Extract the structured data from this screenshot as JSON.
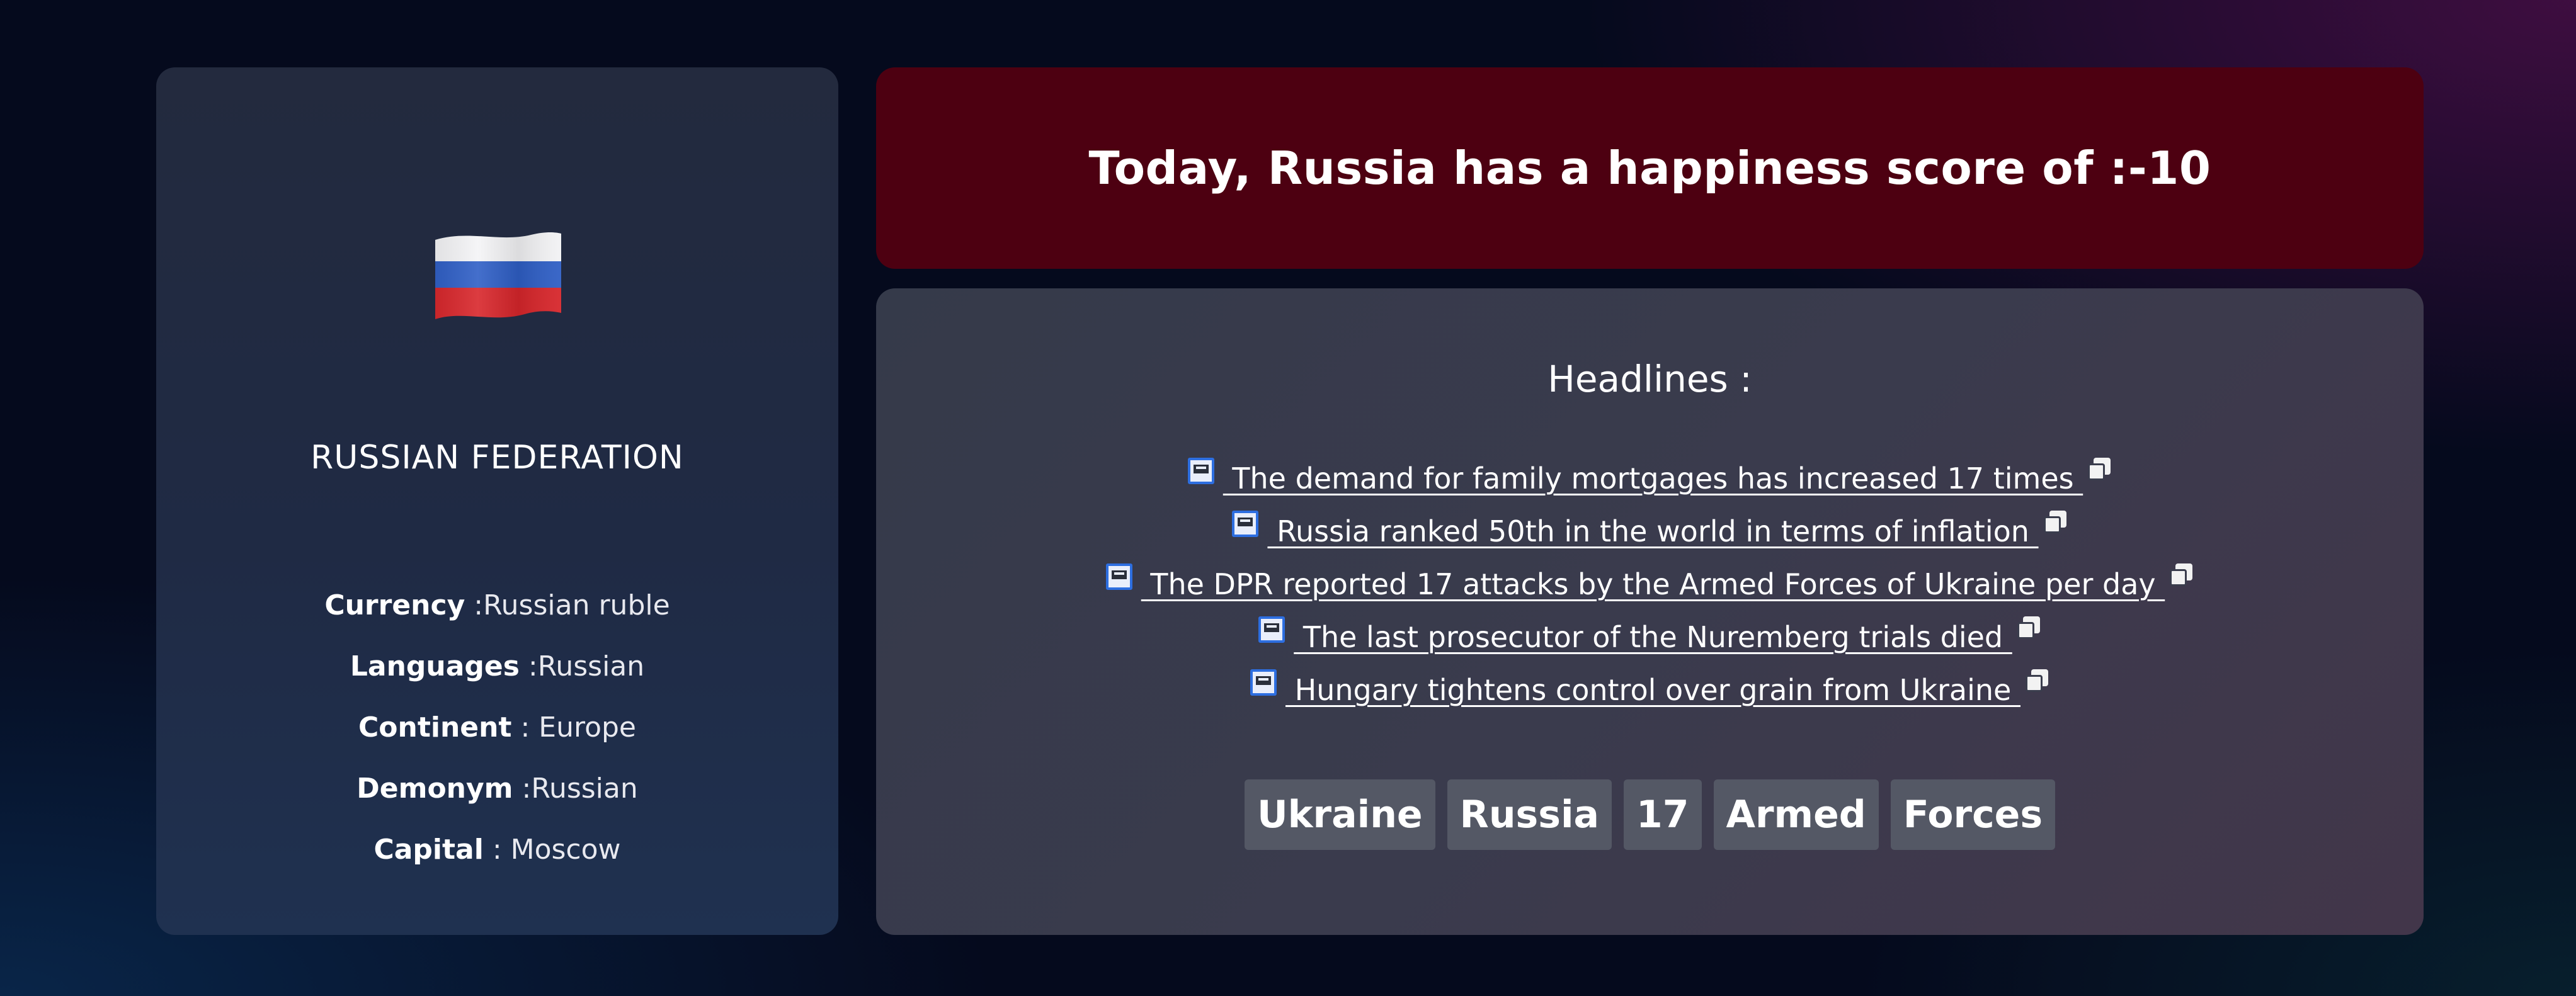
{
  "country": {
    "flag_icon": "russian-flag",
    "name": "RUSSIAN FEDERATION",
    "facts": [
      {
        "key": "Currency",
        "value": " :Russian ruble"
      },
      {
        "key": "Languages",
        "value": " :Russian"
      },
      {
        "key": "Continent",
        "value": " : Europe"
      },
      {
        "key": "Demonym",
        "value": " :Russian"
      },
      {
        "key": "Capital",
        "value": " : Moscow"
      }
    ]
  },
  "score_banner": {
    "text": "Today, Russia has a happiness score of :-10",
    "color": "#4d0011"
  },
  "headlines": {
    "title": "Headlines :",
    "items": [
      {
        "text": " The demand for family mortgages has increased 17 times ",
        "icon": "news-source-icon"
      },
      {
        "text": " Russia ranked 50th in the world in terms of inflation ",
        "icon": "news-source-icon"
      },
      {
        "text": " The DPR reported 17 attacks by the Armed Forces of Ukraine per day ",
        "icon": "news-source-icon"
      },
      {
        "text": " The last prosecutor of the Nuremberg trials died ",
        "icon": "news-source-icon"
      },
      {
        "text": " Hungary tightens control over grain from Ukraine ",
        "icon": "news-source-icon"
      }
    ]
  },
  "keywords": [
    "Ukraine",
    "Russia",
    "17",
    "Armed",
    "Forces"
  ]
}
